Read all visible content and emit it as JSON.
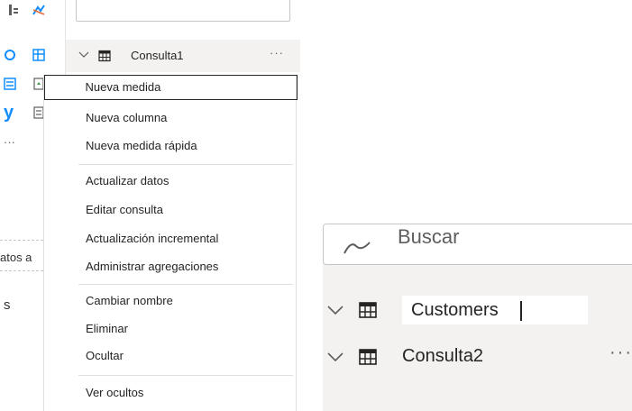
{
  "fields_pane": {
    "tables": [
      {
        "name": "Consulta1",
        "more": "···"
      }
    ]
  },
  "left_fragments": {
    "visual_letter": "y",
    "ellipsis": "···",
    "datos": "atos a",
    "s": "s"
  },
  "context_menu": {
    "items": [
      "Nueva medida",
      "Nueva columna",
      "Nueva medida rápida",
      "Actualizar datos",
      "Editar consulta",
      "Actualización incremental",
      "Administrar agregaciones",
      "Cambiar nombre",
      "Eliminar",
      "Ocultar",
      "Ver ocultos"
    ]
  },
  "zoom_panel": {
    "search": {
      "placeholder": "Buscar"
    },
    "rename_value": "Customers",
    "tables": [
      {
        "name": "Consulta2",
        "more": "···"
      }
    ]
  },
  "icons": {
    "expand": "chevron-down-icon",
    "table": "table-icon",
    "search": "search-icon"
  },
  "colors": {
    "accent": "#118dff",
    "text": "#252423",
    "muted": "#605e5c",
    "hover_bg": "#f3f2f1",
    "border": "#c8c6c4"
  }
}
